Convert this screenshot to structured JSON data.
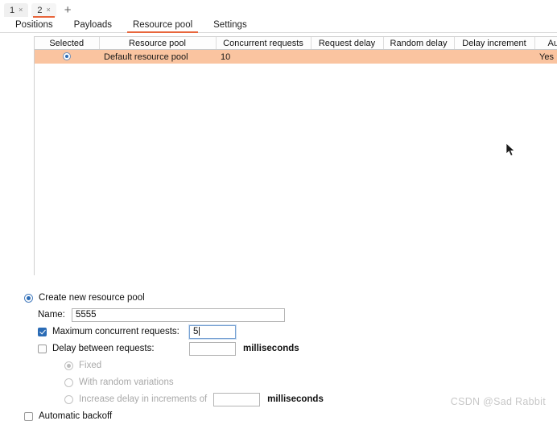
{
  "window": {
    "number_tabs": [
      {
        "label": "1",
        "close": "×",
        "active": false
      },
      {
        "label": "2",
        "close": "×",
        "active": true
      }
    ],
    "add_tab_label": "+"
  },
  "nav": {
    "tabs": [
      {
        "label": "Positions",
        "active": false
      },
      {
        "label": "Payloads",
        "active": false
      },
      {
        "label": "Resource pool",
        "active": true
      },
      {
        "label": "Settings",
        "active": false
      }
    ]
  },
  "table": {
    "columns": [
      "Selected",
      "Resource pool",
      "Concurrent requests",
      "Request delay",
      "Random delay",
      "Delay increment",
      "Auto backoff"
    ],
    "rows": [
      {
        "selected_icon": "radio-selected-icon",
        "resource_pool": "Default resource pool",
        "concurrent_requests": "10",
        "request_delay": "",
        "random_delay": "",
        "delay_increment": "",
        "auto_backoff": "Yes"
      }
    ]
  },
  "form": {
    "create_new_label": "Create new resource pool",
    "create_new_selected": true,
    "name_label": "Name:",
    "name_value": "5555",
    "max_concurrent_label": "Maximum concurrent requests:",
    "max_concurrent_checked": true,
    "max_concurrent_value": "5",
    "delay_between_label": "Delay between requests:",
    "delay_between_checked": false,
    "delay_between_value": "",
    "delay_units": "milliseconds",
    "fixed_label": "Fixed",
    "fixed_selected": true,
    "random_variations_label": "With random variations",
    "random_variations_selected": false,
    "increments_label": "Increase delay in increments of",
    "increments_selected": false,
    "increments_value": "",
    "increments_units": "milliseconds",
    "automatic_backoff_label": "Automatic backoff",
    "automatic_backoff_checked": false
  },
  "watermark": {
    "text": "CSDN @Sad Rabbit"
  },
  "colors": {
    "accent": "#e8663c",
    "row_highlight": "#fac4a0",
    "radio_blue": "#2a6bb5"
  }
}
